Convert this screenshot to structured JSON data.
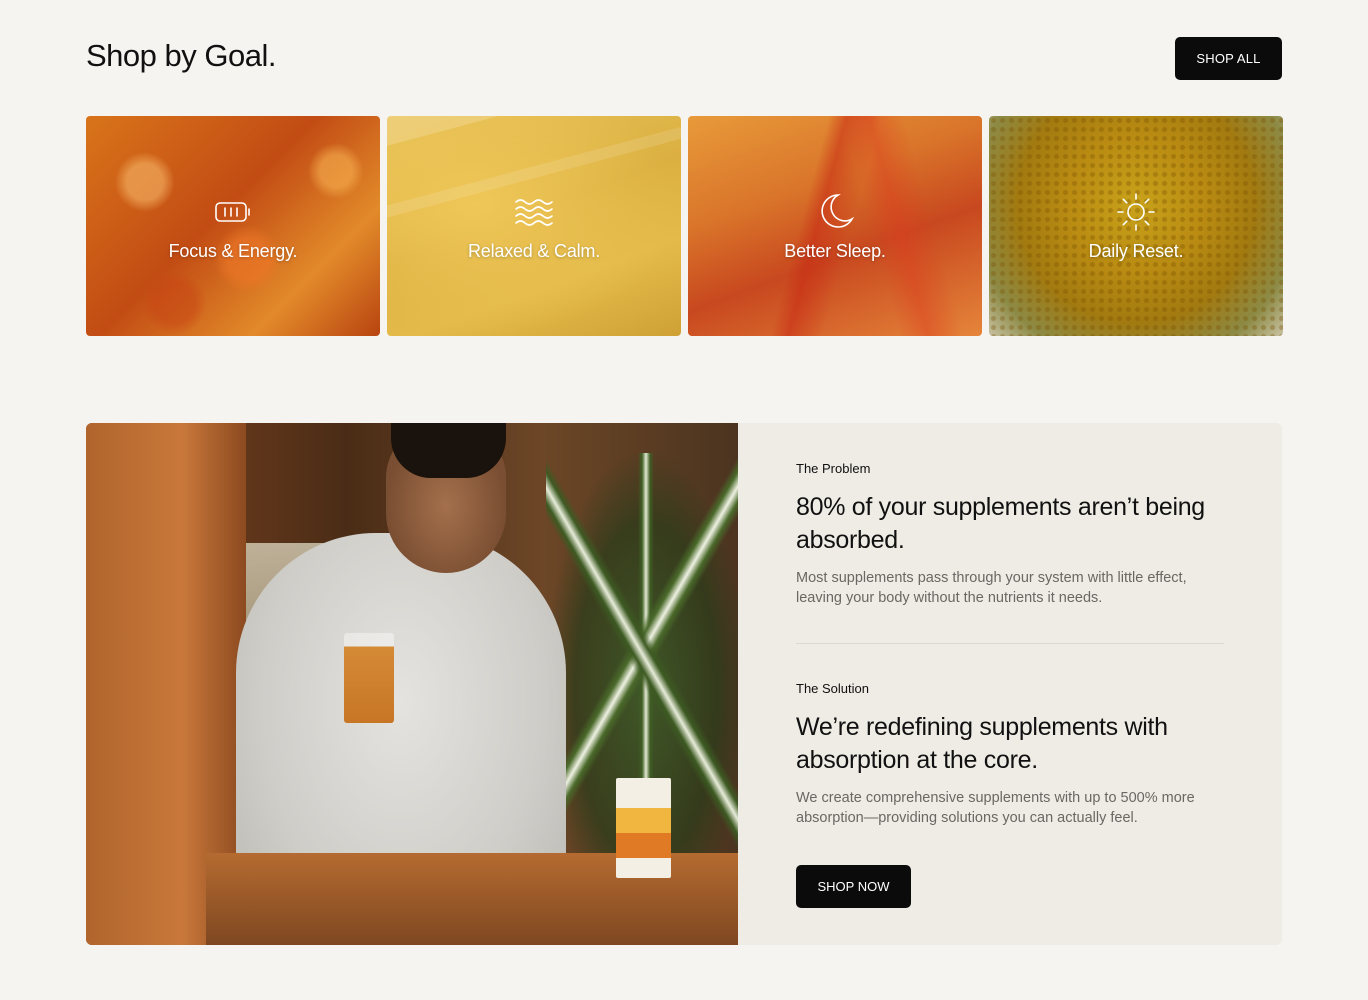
{
  "header": {
    "title": "Shop by Goal.",
    "shop_all_label": "SHOP ALL"
  },
  "goals": [
    {
      "label": "Focus & Energy.",
      "icon": "battery-icon"
    },
    {
      "label": "Relaxed & Calm.",
      "icon": "waves-icon"
    },
    {
      "label": "Better Sleep.",
      "icon": "moon-icon"
    },
    {
      "label": "Daily Reset.",
      "icon": "sun-icon"
    }
  ],
  "feature": {
    "problem": {
      "eyebrow": "The Problem",
      "heading": "80% of your supplements aren’t being absorbed.",
      "body": "Most supplements pass through your system with little effect, leaving your body without the nutrients it needs."
    },
    "solution": {
      "eyebrow": "The Solution",
      "heading": "We’re redefining supplements with absorption at the core.",
      "body": "We create comprehensive supplements with up to 500% more absorption—providing solutions you can actually feel."
    },
    "shop_now_label": "SHOP NOW"
  },
  "colors": {
    "page_bg": "#f6f4f1",
    "button_bg": "#0b0b0b",
    "panel_bg": "#efebe5"
  }
}
